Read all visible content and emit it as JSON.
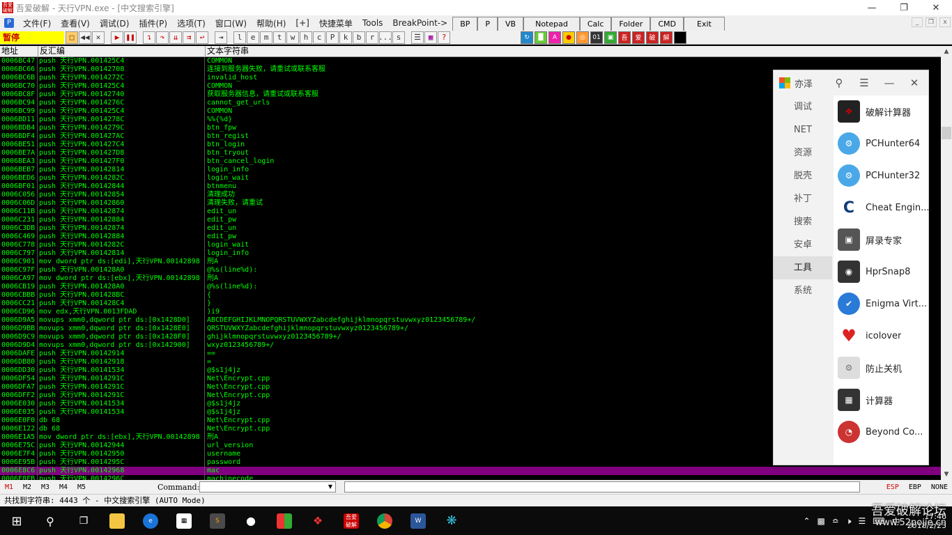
{
  "window": {
    "title": "吾爱破解 - 天行VPN.exe - [中文搜索引擎]",
    "icon_text": "吾爱破解",
    "controls": [
      "minimize-icon",
      "restore-icon",
      "close-icon"
    ]
  },
  "menubar": {
    "items": [
      "文件(F)",
      "查看(V)",
      "调试(D)",
      "插件(P)",
      "选项(T)",
      "窗口(W)",
      "帮助(H)",
      "[+]",
      "快捷菜单",
      "Tools",
      "BreakPoint->"
    ],
    "tool_tabs": [
      "BP",
      "P",
      "VB",
      "Notepad",
      "Calc",
      "Folder",
      "CMD",
      "Exit"
    ]
  },
  "toolbar": {
    "status": "暂停",
    "letter_buttons": [
      "l",
      "e",
      "m",
      "t",
      "w",
      "h",
      "c",
      "P",
      "k",
      "b",
      "r",
      "...",
      "s"
    ]
  },
  "columns": [
    "地址",
    "反汇编",
    "文本字符串"
  ],
  "rows": [
    {
      "addr": "0006BC47",
      "asm": "push 天行VPN.001425C4",
      "text": "COMMON"
    },
    {
      "addr": "0006BC66",
      "asm": "push 天行VPN.00142708",
      "text": "连接到服务器失败，请重试或联系客服"
    },
    {
      "addr": "0006BC6B",
      "asm": "push 天行VPN.0014272C",
      "text": "invalid_host"
    },
    {
      "addr": "0006BC70",
      "asm": "push 天行VPN.001425C4",
      "text": "COMMON"
    },
    {
      "addr": "0006BC8F",
      "asm": "push 天行VPN.00142740",
      "text": "获取服务器信息，请重试或联系客服"
    },
    {
      "addr": "0006BC94",
      "asm": "push 天行VPN.0014276C",
      "text": "cannot_get_urls"
    },
    {
      "addr": "0006BC99",
      "asm": "push 天行VPN.001425C4",
      "text": "COMMON"
    },
    {
      "addr": "0006BD11",
      "asm": "push 天行VPN.0014278C",
      "text": "%%{%d}"
    },
    {
      "addr": "0006BDB4",
      "asm": "push 天行VPN.0014279C",
      "text": "btn_fpw"
    },
    {
      "addr": "0006BDF4",
      "asm": "push 天行VPN.001427AC",
      "text": "btn_regist"
    },
    {
      "addr": "0006BE51",
      "asm": "push 天行VPN.001427C4",
      "text": "btn_login"
    },
    {
      "addr": "0006BE7A",
      "asm": "push 天行VPN.001427D8",
      "text": "btn_tryout"
    },
    {
      "addr": "0006BEA3",
      "asm": "push 天行VPN.001427F0",
      "text": "btn_cancel_login"
    },
    {
      "addr": "0006BEB7",
      "asm": "push 天行VPN.00142814",
      "text": "login_info"
    },
    {
      "addr": "0006BED6",
      "asm": "push 天行VPN.0014282C",
      "text": "login_wait"
    },
    {
      "addr": "0006BF01",
      "asm": "push 天行VPN.00142844",
      "text": "btnmenu"
    },
    {
      "addr": "0006C056",
      "asm": "push 天行VPN.00142854",
      "text": "清理成功"
    },
    {
      "addr": "0006C06D",
      "asm": "push 天行VPN.00142860",
      "text": "清理失败，请重试"
    },
    {
      "addr": "0006C11B",
      "asm": "push 天行VPN.00142874",
      "text": "edit_un"
    },
    {
      "addr": "0006C231",
      "asm": "push 天行VPN.00142884",
      "text": "edit_pw"
    },
    {
      "addr": "0006C3DB",
      "asm": "push 天行VPN.00142874",
      "text": "edit_un"
    },
    {
      "addr": "0006C469",
      "asm": "push 天行VPN.00142884",
      "text": "edit_pw"
    },
    {
      "addr": "0006C778",
      "asm": "push 天行VPN.0014282C",
      "text": "login_wait"
    },
    {
      "addr": "0006C797",
      "asm": "push 天行VPN.00142814",
      "text": "login_info"
    },
    {
      "addr": "0006C901",
      "asm": "mov dword ptr ds:[edi],天行VPN.00142898",
      "text": "刑A"
    },
    {
      "addr": "0006C97F",
      "asm": "push 天行VPN.001428A0",
      "text": "@%s(line%d):"
    },
    {
      "addr": "0006CA97",
      "asm": "mov dword ptr ds:[ebx],天行VPN.00142898",
      "text": "刑A"
    },
    {
      "addr": "0006CB19",
      "asm": "push 天行VPN.001428A0",
      "text": "@%s(line%d):"
    },
    {
      "addr": "0006CBBB",
      "asm": "push 天行VPN.001428BC",
      "text": "{"
    },
    {
      "addr": "0006CC21",
      "asm": "push 天行VPN.001428C4",
      "text": " }"
    },
    {
      "addr": "0006CD96",
      "asm": "mov edx,天行VPN.0013FDAD",
      "text": ")i9"
    },
    {
      "addr": "0006D9A5",
      "asm": "movups xmm0,dqword ptr ds:[0x1428D0]",
      "text": "ABCDEFGHIJKLMNOPQRSTUVWXYZabcdefghijklmnopqrstuvwxyz0123456789+/"
    },
    {
      "addr": "0006D9BB",
      "asm": "movups xmm0,dqword ptr ds:[0x1428E0]",
      "text": "QRSTUVWXYZabcdefghijklmnopqrstuvwxyz0123456789+/"
    },
    {
      "addr": "0006D9C9",
      "asm": "movups xmm0,dqword ptr ds:[0x1428F0]",
      "text": "ghijklmnopqrstuvwxyz0123456789+/"
    },
    {
      "addr": "0006D9D4",
      "asm": "movups xmm0,dqword ptr ds:[0x142900]",
      "text": "wxyz0123456789+/"
    },
    {
      "addr": "0006DAFE",
      "asm": "push 天行VPN.00142914",
      "text": "=="
    },
    {
      "addr": "0006DB80",
      "asm": "push 天行VPN.00142918",
      "text": "="
    },
    {
      "addr": "0006DD30",
      "asm": "push 天行VPN.00141534",
      "text": "@$s1j4jz"
    },
    {
      "addr": "0006DF54",
      "asm": "push 天行VPN.0014291C",
      "text": "Net\\Encrypt.cpp"
    },
    {
      "addr": "0006DFA7",
      "asm": "push 天行VPN.0014291C",
      "text": "Net\\Encrypt.cpp"
    },
    {
      "addr": "0006DFF2",
      "asm": "push 天行VPN.0014291C",
      "text": "Net\\Encrypt.cpp"
    },
    {
      "addr": "0006E030",
      "asm": "push 天行VPN.00141534",
      "text": "@$s1j4jz"
    },
    {
      "addr": "0006E035",
      "asm": "push 天行VPN.00141534",
      "text": "@$s1j4jz"
    },
    {
      "addr": "0006E0F0",
      "asm": "db 68",
      "text": "Net\\Encrypt.cpp"
    },
    {
      "addr": "0006E122",
      "asm": "db 68",
      "text": "Net\\Encrypt.cpp"
    },
    {
      "addr": "0006E1A5",
      "asm": "mov dword ptr ds:[ebx],天行VPN.00142898",
      "text": "刑A"
    },
    {
      "addr": "0006E75C",
      "asm": "push 天行VPN.00142944",
      "text": "url_version"
    },
    {
      "addr": "0006E7F4",
      "asm": "push 天行VPN.00142950",
      "text": "username"
    },
    {
      "addr": "0006E95B",
      "asm": "push 天行VPN.0014295C",
      "text": "password"
    },
    {
      "addr": "0006E8C6",
      "asm": "push 天行VPN.00142968",
      "text": "mac",
      "selected": true
    },
    {
      "addr": "0006E8FB",
      "asm": "push 天行VPN.0014296C",
      "text": "machinecode"
    }
  ],
  "command_bar": {
    "markers": [
      "M1",
      "M2",
      "M3",
      "M4",
      "M5"
    ],
    "label": "Command:",
    "registers": [
      "ESP",
      "EBP",
      "NONE"
    ]
  },
  "status": "共找到字符串: 4443 个  -  中文搜索引擎 (AUTO Mode)",
  "launcher": {
    "name": "亦泽",
    "categories": [
      "调试",
      "NET",
      "资源",
      "脱壳",
      "补丁",
      "搜索",
      "安卓",
      "工具",
      "系统"
    ],
    "active_category": "工具",
    "apps": [
      "破解计算器",
      "PCHunter64",
      "PCHunter32",
      "Cheat Engin...",
      "屏录专家",
      "HprSnap8",
      "Enigma Virt...",
      "icolover",
      "防止关机",
      "计算器",
      "Beyond Co..."
    ]
  },
  "taskbar": {
    "clock_time": "17:46",
    "clock_date": "2018/2/23",
    "ime": "中",
    "watermark": "吾爱破解论坛",
    "watermark_url": "www.52pojie.cn"
  }
}
